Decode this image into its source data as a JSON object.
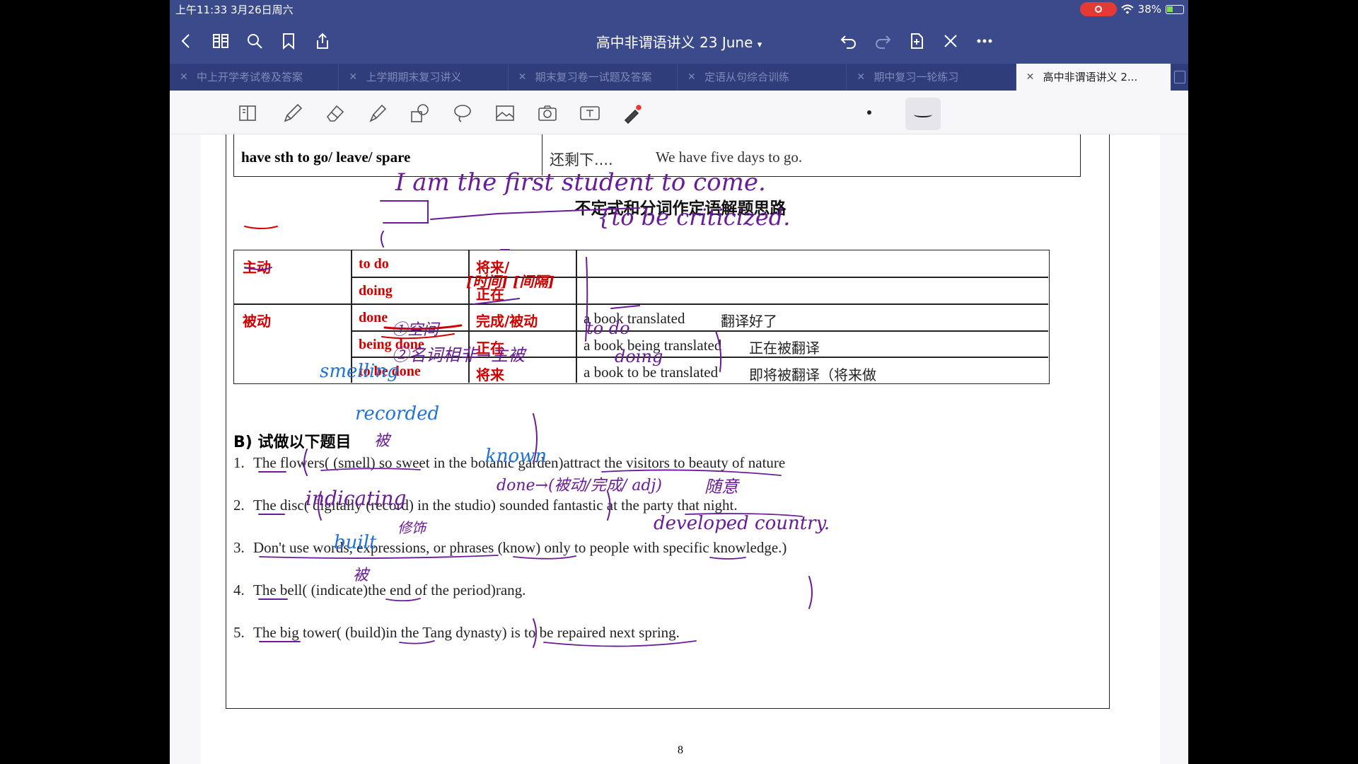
{
  "status": {
    "time": "上午11:33  3月26日周六",
    "battery": "38%"
  },
  "nav": {
    "title": "高中非谓语讲义 23 June",
    "chevron": "▾"
  },
  "tabs": [
    {
      "label": "中上开学考试卷及答案",
      "active": false
    },
    {
      "label": "上学期期末复习讲义",
      "active": false
    },
    {
      "label": "期末复习卷一试题及答案",
      "active": false
    },
    {
      "label": "定语从句综合训练",
      "active": false
    },
    {
      "label": "期中复习一轮练习",
      "active": false
    },
    {
      "label": "高中非谓语讲义 2...",
      "active": true
    }
  ],
  "toolbar": {
    "tools": [
      "page-view-icon",
      "pen-icon",
      "eraser-icon",
      "highlighter-icon",
      "shapes-icon",
      "lasso-icon",
      "image-icon",
      "camera-icon",
      "text-icon",
      "laser-icon"
    ]
  },
  "document": {
    "top_row": {
      "phrase": "have sth to go/ leave/ spare",
      "meaning": "还剩下....",
      "example": "We have five days to go."
    },
    "section_title": "不定式和分词作定语解题思路",
    "grid": {
      "voice_active": "主动",
      "voice_passive": "被动",
      "rows": [
        {
          "form": "to do",
          "meaning": "将来/",
          "example": ""
        },
        {
          "form": "doing",
          "meaning": "正在",
          "example": ""
        },
        {
          "form": "done",
          "meaning": "完成/被动",
          "example": "a book translated",
          "note": "翻译好了"
        },
        {
          "form": "being done",
          "meaning": "正在",
          "example": "a book being translated",
          "note": "正在被翻译"
        },
        {
          "form": "to be done",
          "meaning": "将来",
          "example": "a book to be translated",
          "note": "即将被翻译（将来做"
        }
      ]
    },
    "section_b": "B)  试做以下题目",
    "questions": [
      {
        "num": "1.",
        "text": "The flowers(            (smell) so sweet in the botanic garden)attract the visitors to beauty of nature"
      },
      {
        "num": "2.",
        "text": "The disc( digitally              (record) in the studio) sounded fantastic at the party that night."
      },
      {
        "num": "3.",
        "text": "Don't use words, expressions, or phrases              (know) only to people with specific knowledge.)"
      },
      {
        "num": "4.",
        "text": "The bell(                   (indicate)the end of the period)rang."
      },
      {
        "num": "5.",
        "text": "The big tower(              (build)in the Tang dynasty) is to be repaired next spring."
      }
    ],
    "page_number": "8"
  },
  "ink": {
    "example_sentence": "I am the first student to come.",
    "criticized": "{to be criticized.",
    "time_words": "[时间] [间隔]",
    "note1": "①空间",
    "note2": "②名词相非→主被",
    "to_do": "to do",
    "doing": "doing",
    "a1": "smelling",
    "a2": "recorded",
    "a3": "known",
    "a4": "indicating",
    "a5": "built",
    "bei1": "被",
    "bei2": "被",
    "done_note": "done→(被动/完成/ adj)",
    "sui_yi": "随意",
    "pian_zhi": "修饰",
    "developed": "developed  country."
  }
}
